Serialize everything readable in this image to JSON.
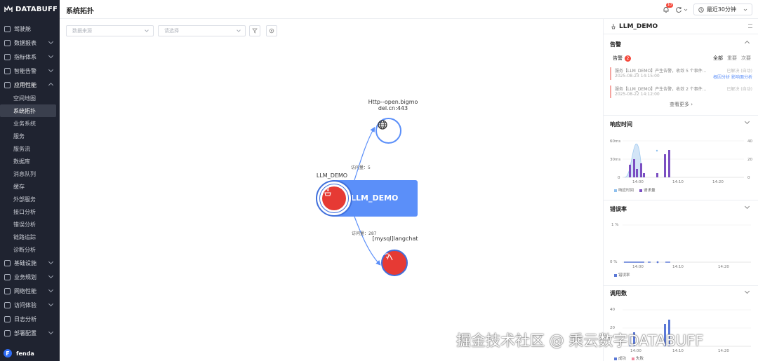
{
  "brand": {
    "name": "DATABUFF"
  },
  "sidebar": {
    "items": [
      {
        "label": "驾驶舱",
        "has_children": false
      },
      {
        "label": "数据报表",
        "has_children": true
      },
      {
        "label": "指标体系",
        "has_children": true
      },
      {
        "label": "智能告警",
        "has_children": true
      },
      {
        "label": "应用性能",
        "has_children": true,
        "open": true
      }
    ],
    "sub_items": [
      "空间地图",
      "系统拓扑",
      "业务系统",
      "服务",
      "服务流",
      "数据库",
      "消息队列",
      "缓存",
      "外部服务",
      "接口分析",
      "错误分析",
      "链路追踪",
      "诊断分析"
    ],
    "active_sub": "系统拓扑",
    "items_after": [
      {
        "label": "基础设施"
      },
      {
        "label": "业务规划"
      },
      {
        "label": "网络性能"
      },
      {
        "label": "访问体验"
      },
      {
        "label": "日志分析",
        "has_children": false
      },
      {
        "label": "部署配置"
      }
    ],
    "user": {
      "initial": "F",
      "name": "fenda"
    }
  },
  "header": {
    "title": "系统拓扑",
    "notification_count": "10",
    "time_range": "最近30分钟"
  },
  "filters": {
    "datasource_placeholder": "数据来源",
    "select_placeholder": "请选择"
  },
  "topology": {
    "center": {
      "label": "LLM_DEMO",
      "bar_text": "LLM_DEMO"
    },
    "http": {
      "label_line1": "Http--open.bigmo",
      "label_line2": "del.cn:443"
    },
    "mysql": {
      "label": "[mysql]langchat"
    },
    "edges": [
      {
        "label": "访问量：5"
      },
      {
        "label": "访问量：287"
      }
    ]
  },
  "panel": {
    "title": "LLM_DEMO",
    "alerts": {
      "section": "告警",
      "tab_label": "告警",
      "count": "2",
      "filters": [
        "全部",
        "重要",
        "次要"
      ],
      "items": [
        {
          "text": "服务【LLM_DEMO】产生告警，收敛 5 个事件...",
          "time": "2025-08-23 14:15:00",
          "status": "已解决 (自动)",
          "actions": "根因分析   影响面分析"
        },
        {
          "text": "服务【LLM_DEMO】产生告警，收敛 2 个事件...",
          "time": "2025-08-22 14:12:00",
          "status": "已解决 (自动)",
          "actions": ""
        }
      ],
      "more": "查看更多"
    },
    "response": {
      "section": "响应时间",
      "left_ticks": [
        "60ms",
        "30ms",
        "0"
      ],
      "right_ticks": [
        "40",
        "20",
        "0"
      ],
      "x_ticks": [
        "14:00",
        "14:10",
        "14:20"
      ],
      "legend": [
        "响应时间",
        "请求量"
      ]
    },
    "error": {
      "section": "错误率",
      "left_ticks": [
        "1 %",
        "0 %"
      ],
      "x_ticks": [
        "14:00",
        "14:10",
        "14:20"
      ],
      "legend": [
        "错误率"
      ]
    },
    "calls": {
      "section": "调用数",
      "left_ticks": [
        "40",
        "20"
      ],
      "x_ticks": [
        "14:00",
        "14:10",
        "14:20"
      ],
      "legend": [
        "成功",
        "失败"
      ]
    }
  },
  "watermark": "掘金技术社区 @ 乘云数字DATABUFF",
  "colors": {
    "sidebar_bg": "#1f2330",
    "accent": "#5b8ff9",
    "danger": "#e63a34",
    "bar_purple": "#7b4fc2"
  }
}
